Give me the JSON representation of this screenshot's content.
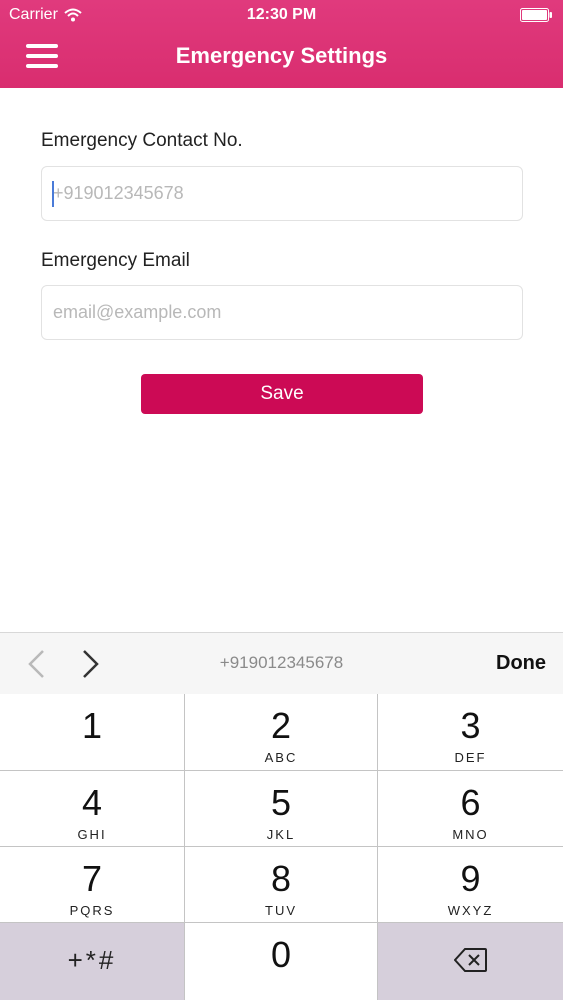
{
  "status_bar": {
    "carrier": "Carrier",
    "time": "12:30 PM"
  },
  "nav": {
    "title": "Emergency Settings"
  },
  "form": {
    "phone_label": "Emergency Contact No.",
    "phone_placeholder": "+919012345678",
    "email_label": "Emergency Email",
    "email_placeholder": "email@example.com",
    "save_label": "Save"
  },
  "accessory": {
    "value": "+919012345678",
    "done_label": "Done"
  },
  "keypad": {
    "keys": [
      {
        "digit": "1",
        "letters": ""
      },
      {
        "digit": "2",
        "letters": "ABC"
      },
      {
        "digit": "3",
        "letters": "DEF"
      },
      {
        "digit": "4",
        "letters": "GHI"
      },
      {
        "digit": "5",
        "letters": "JKL"
      },
      {
        "digit": "6",
        "letters": "MNO"
      },
      {
        "digit": "7",
        "letters": "PQRS"
      },
      {
        "digit": "8",
        "letters": "TUV"
      },
      {
        "digit": "9",
        "letters": "WXYZ"
      }
    ],
    "symbols": "+*#",
    "zero": "0"
  },
  "colors": {
    "header": "#d92d6f",
    "save_button": "#cc0a55",
    "caret": "#4a7bd8"
  },
  "icons": [
    "wifi-icon",
    "battery-icon",
    "menu-icon",
    "chevron-left-icon",
    "chevron-right-icon",
    "backspace-icon"
  ]
}
